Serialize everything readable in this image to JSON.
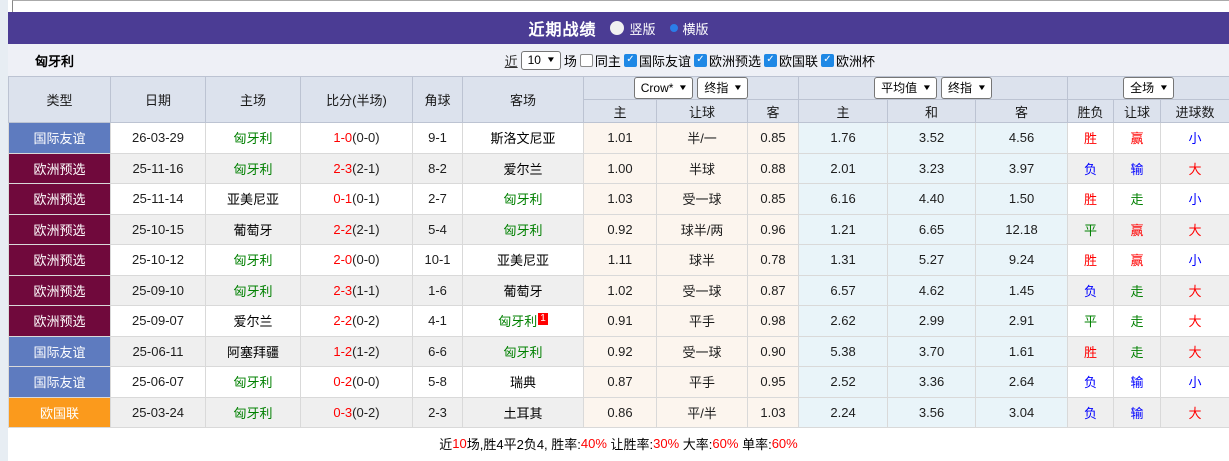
{
  "icons": {
    "caret_down": "▼",
    "check": "✓"
  },
  "title_bar": {
    "title": "近期战绩",
    "radios": [
      {
        "label": "竖版",
        "checked": false
      },
      {
        "label": "横版",
        "checked": true
      }
    ]
  },
  "filter_bar": {
    "team": "匈牙利",
    "near": "近",
    "count": "10",
    "games": "场",
    "checkboxes": [
      {
        "label": "同主",
        "checked": false
      },
      {
        "label": "国际友谊",
        "checked": true
      },
      {
        "label": "欧洲预选",
        "checked": true
      },
      {
        "label": "欧国联",
        "checked": true
      },
      {
        "label": "欧洲杯",
        "checked": true
      }
    ]
  },
  "table": {
    "selects": {
      "crow_source": "Crow*",
      "crow_time": "终指",
      "avg_source": "平均值",
      "avg_time": "终指",
      "scope": "全场"
    },
    "headers": {
      "type": "类型",
      "date": "日期",
      "home": "主场",
      "score": "比分(半场)",
      "corner": "角球",
      "away": "客场",
      "crow_home": "主",
      "crow_let": "让球",
      "crow_away": "客",
      "avg_home": "主",
      "avg_draw": "和",
      "avg_away": "客",
      "wdl": "胜负",
      "let2": "让球",
      "goals": "进球数"
    },
    "colors": {
      "friendly_badge": "#5e7bbf",
      "qualifier_badge": "#70093c",
      "nations_badge": "#fb9a1c",
      "win_red": "#ff0000",
      "draw_green": "#008000",
      "lose_blue": "#0000ff",
      "hungary_green": "#008000",
      "team_black": "#000000",
      "accent_blue": "#1e88e5",
      "titlebar_purple": "#4b3c94"
    },
    "rows": [
      {
        "type": "国际友谊",
        "type_color": "#5e7bbf",
        "date": "26-03-29",
        "home": "匈牙利",
        "home_color": "#008000",
        "score_main": "1-0",
        "score_half": "(0-0)",
        "corner": "9-1",
        "away": "斯洛文尼亚",
        "away_color": "#000000",
        "away_sup": "",
        "crow_home": "1.01",
        "crow_let": "半/一",
        "crow_away": "0.85",
        "avg_home": "1.76",
        "avg_draw": "3.52",
        "avg_away": "4.56",
        "wdl": "胜",
        "wdl_color": "#ff0000",
        "hlet": "赢",
        "hlet_color": "#ff0000",
        "goal": "小",
        "goal_color": "#0000ff"
      },
      {
        "type": "欧洲预选",
        "type_color": "#70093c",
        "date": "25-11-16",
        "home": "匈牙利",
        "home_color": "#008000",
        "score_main": "2-3",
        "score_half": "(2-1)",
        "corner": "8-2",
        "away": "爱尔兰",
        "away_color": "#000000",
        "away_sup": "",
        "crow_home": "1.00",
        "crow_let": "半球",
        "crow_away": "0.88",
        "avg_home": "2.01",
        "avg_draw": "3.23",
        "avg_away": "3.97",
        "wdl": "负",
        "wdl_color": "#0000ff",
        "hlet": "输",
        "hlet_color": "#0000ff",
        "goal": "大",
        "goal_color": "#ff0000"
      },
      {
        "type": "欧洲预选",
        "type_color": "#70093c",
        "date": "25-11-14",
        "home": "亚美尼亚",
        "home_color": "#000000",
        "score_main": "0-1",
        "score_half": "(0-1)",
        "corner": "2-7",
        "away": "匈牙利",
        "away_color": "#008000",
        "away_sup": "",
        "crow_home": "1.03",
        "crow_let": "受一球",
        "crow_away": "0.85",
        "avg_home": "6.16",
        "avg_draw": "4.40",
        "avg_away": "1.50",
        "wdl": "胜",
        "wdl_color": "#ff0000",
        "hlet": "走",
        "hlet_color": "#008000",
        "goal": "小",
        "goal_color": "#0000ff"
      },
      {
        "type": "欧洲预选",
        "type_color": "#70093c",
        "date": "25-10-15",
        "home": "葡萄牙",
        "home_color": "#000000",
        "score_main": "2-2",
        "score_half": "(2-1)",
        "corner": "5-4",
        "away": "匈牙利",
        "away_color": "#008000",
        "away_sup": "",
        "crow_home": "0.92",
        "crow_let": "球半/两",
        "crow_away": "0.96",
        "avg_home": "1.21",
        "avg_draw": "6.65",
        "avg_away": "12.18",
        "wdl": "平",
        "wdl_color": "#008000",
        "hlet": "赢",
        "hlet_color": "#ff0000",
        "goal": "大",
        "goal_color": "#ff0000"
      },
      {
        "type": "欧洲预选",
        "type_color": "#70093c",
        "date": "25-10-12",
        "home": "匈牙利",
        "home_color": "#008000",
        "score_main": "2-0",
        "score_half": "(0-0)",
        "corner": "10-1",
        "away": "亚美尼亚",
        "away_color": "#000000",
        "away_sup": "",
        "crow_home": "1.11",
        "crow_let": "球半",
        "crow_away": "0.78",
        "avg_home": "1.31",
        "avg_draw": "5.27",
        "avg_away": "9.24",
        "wdl": "胜",
        "wdl_color": "#ff0000",
        "hlet": "赢",
        "hlet_color": "#ff0000",
        "goal": "小",
        "goal_color": "#0000ff"
      },
      {
        "type": "欧洲预选",
        "type_color": "#70093c",
        "date": "25-09-10",
        "home": "匈牙利",
        "home_color": "#008000",
        "score_main": "2-3",
        "score_half": "(1-1)",
        "corner": "1-6",
        "away": "葡萄牙",
        "away_color": "#000000",
        "away_sup": "",
        "crow_home": "1.02",
        "crow_let": "受一球",
        "crow_away": "0.87",
        "avg_home": "6.57",
        "avg_draw": "4.62",
        "avg_away": "1.45",
        "wdl": "负",
        "wdl_color": "#0000ff",
        "hlet": "走",
        "hlet_color": "#008000",
        "goal": "大",
        "goal_color": "#ff0000"
      },
      {
        "type": "欧洲预选",
        "type_color": "#70093c",
        "date": "25-09-07",
        "home": "爱尔兰",
        "home_color": "#000000",
        "score_main": "2-2",
        "score_half": "(0-2)",
        "corner": "4-1",
        "away": "匈牙利",
        "away_color": "#008000",
        "away_sup": "1",
        "crow_home": "0.91",
        "crow_let": "平手",
        "crow_away": "0.98",
        "avg_home": "2.62",
        "avg_draw": "2.99",
        "avg_away": "2.91",
        "wdl": "平",
        "wdl_color": "#008000",
        "hlet": "走",
        "hlet_color": "#008000",
        "goal": "大",
        "goal_color": "#ff0000"
      },
      {
        "type": "国际友谊",
        "type_color": "#5e7bbf",
        "date": "25-06-11",
        "home": "阿塞拜疆",
        "home_color": "#000000",
        "score_main": "1-2",
        "score_half": "(1-2)",
        "corner": "6-6",
        "away": "匈牙利",
        "away_color": "#008000",
        "away_sup": "",
        "crow_home": "0.92",
        "crow_let": "受一球",
        "crow_away": "0.90",
        "avg_home": "5.38",
        "avg_draw": "3.70",
        "avg_away": "1.61",
        "wdl": "胜",
        "wdl_color": "#ff0000",
        "hlet": "走",
        "hlet_color": "#008000",
        "goal": "大",
        "goal_color": "#ff0000"
      },
      {
        "type": "国际友谊",
        "type_color": "#5e7bbf",
        "date": "25-06-07",
        "home": "匈牙利",
        "home_color": "#008000",
        "score_main": "0-2",
        "score_half": "(0-0)",
        "corner": "5-8",
        "away": "瑞典",
        "away_color": "#000000",
        "away_sup": "",
        "crow_home": "0.87",
        "crow_let": "平手",
        "crow_away": "0.95",
        "avg_home": "2.52",
        "avg_draw": "3.36",
        "avg_away": "2.64",
        "wdl": "负",
        "wdl_color": "#0000ff",
        "hlet": "输",
        "hlet_color": "#0000ff",
        "goal": "小",
        "goal_color": "#0000ff"
      },
      {
        "type": "欧国联",
        "type_color": "#fb9a1c",
        "date": "25-03-24",
        "home": "匈牙利",
        "home_color": "#008000",
        "score_main": "0-3",
        "score_half": "(0-2)",
        "corner": "2-3",
        "away": "土耳其",
        "away_color": "#000000",
        "away_sup": "",
        "crow_home": "0.86",
        "crow_let": "平/半",
        "crow_away": "1.03",
        "avg_home": "2.24",
        "avg_draw": "3.56",
        "avg_away": "3.04",
        "wdl": "负",
        "wdl_color": "#0000ff",
        "hlet": "输",
        "hlet_color": "#0000ff",
        "goal": "大",
        "goal_color": "#ff0000"
      }
    ]
  },
  "footer": {
    "parts": [
      {
        "text": "近",
        "color": "#000000"
      },
      {
        "text": "10",
        "color": "#ff0000"
      },
      {
        "text": "场,胜4平2负4, 胜率:",
        "color": "#000000"
      },
      {
        "text": "40%",
        "color": "#ff0000"
      },
      {
        "text": " 让胜率:",
        "color": "#000000"
      },
      {
        "text": "30%",
        "color": "#ff0000"
      },
      {
        "text": " 大率:",
        "color": "#000000"
      },
      {
        "text": "60%",
        "color": "#ff0000"
      },
      {
        "text": " 单率:",
        "color": "#000000"
      },
      {
        "text": "60%",
        "color": "#ff0000"
      }
    ]
  }
}
